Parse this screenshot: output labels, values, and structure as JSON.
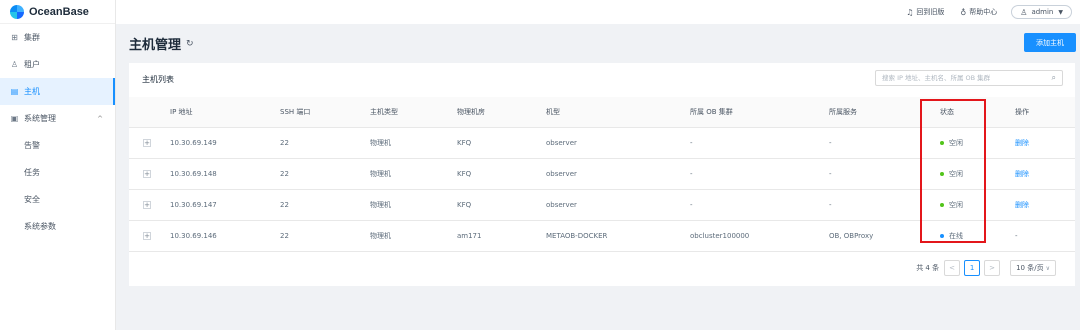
{
  "app": {
    "logo": "OceanBase"
  },
  "sidebar": {
    "items": [
      {
        "label": "集群",
        "icon": "grid-icon"
      },
      {
        "label": "租户",
        "icon": "tenant-icon"
      },
      {
        "label": "主机",
        "icon": "host-icon",
        "active": true
      },
      {
        "label": "系统管理",
        "icon": "system-icon",
        "expanded": true
      }
    ],
    "subitems": [
      {
        "label": "告警"
      },
      {
        "label": "任务"
      },
      {
        "label": "安全"
      },
      {
        "label": "系统参数"
      }
    ]
  },
  "topbar": {
    "back_label": "回到旧版",
    "help_label": "帮助中心",
    "user": "admin"
  },
  "page": {
    "title": "主机管理",
    "add_button": "添加主机"
  },
  "card": {
    "title": "主机列表",
    "search_placeholder": "搜索 IP 地址、主机名、所属 OB 集群"
  },
  "table": {
    "headers": [
      "IP 地址",
      "SSH 端口",
      "主机类型",
      "物理机房",
      "机型",
      "所属 OB 集群",
      "所属服务",
      "状态",
      "操作"
    ],
    "rows": [
      {
        "expand": "+",
        "ip": "10.30.69.149",
        "ssh": "22",
        "type": "物理机",
        "idc": "KFQ",
        "model": "observer",
        "cluster": "-",
        "service": "-",
        "status": "空闲",
        "status_color": "#52c41a",
        "action": "删除"
      },
      {
        "expand": "+",
        "ip": "10.30.69.148",
        "ssh": "22",
        "type": "物理机",
        "idc": "KFQ",
        "model": "observer",
        "cluster": "-",
        "service": "-",
        "status": "空闲",
        "status_color": "#52c41a",
        "action": "删除"
      },
      {
        "expand": "+",
        "ip": "10.30.69.147",
        "ssh": "22",
        "type": "物理机",
        "idc": "KFQ",
        "model": "observer",
        "cluster": "-",
        "service": "-",
        "status": "空闲",
        "status_color": "#52c41a",
        "action": "删除"
      },
      {
        "expand": "+",
        "ip": "10.30.69.146",
        "ssh": "22",
        "type": "物理机",
        "idc": "am171",
        "model": "METAOB-DOCKER",
        "cluster": "obcluster100000",
        "service": "OB, OBProxy",
        "status": "在线",
        "status_color": "#1890ff",
        "action": "-"
      }
    ]
  },
  "pagination": {
    "total": "共 4 条",
    "prev": "<",
    "current": "1",
    "next": ">",
    "page_size": "10 条/页"
  },
  "colors": {
    "accent": "#1890ff",
    "idle": "#52c41a",
    "online": "#1890ff",
    "highlight": "#e3161b"
  }
}
